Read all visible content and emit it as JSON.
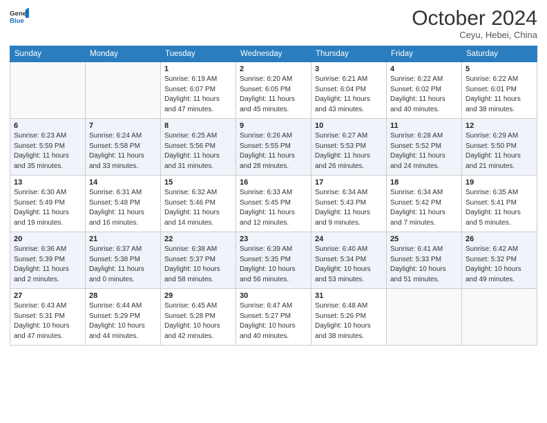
{
  "logo": {
    "general": "General",
    "blue": "Blue"
  },
  "title": "October 2024",
  "subtitle": "Ceyu, Hebei, China",
  "days_header": [
    "Sunday",
    "Monday",
    "Tuesday",
    "Wednesday",
    "Thursday",
    "Friday",
    "Saturday"
  ],
  "weeks": [
    {
      "shade": false,
      "days": [
        {
          "num": "",
          "info": ""
        },
        {
          "num": "",
          "info": ""
        },
        {
          "num": "1",
          "info": "Sunrise: 6:19 AM\nSunset: 6:07 PM\nDaylight: 11 hours and 47 minutes."
        },
        {
          "num": "2",
          "info": "Sunrise: 6:20 AM\nSunset: 6:05 PM\nDaylight: 11 hours and 45 minutes."
        },
        {
          "num": "3",
          "info": "Sunrise: 6:21 AM\nSunset: 6:04 PM\nDaylight: 11 hours and 43 minutes."
        },
        {
          "num": "4",
          "info": "Sunrise: 6:22 AM\nSunset: 6:02 PM\nDaylight: 11 hours and 40 minutes."
        },
        {
          "num": "5",
          "info": "Sunrise: 6:22 AM\nSunset: 6:01 PM\nDaylight: 11 hours and 38 minutes."
        }
      ]
    },
    {
      "shade": true,
      "days": [
        {
          "num": "6",
          "info": "Sunrise: 6:23 AM\nSunset: 5:59 PM\nDaylight: 11 hours and 35 minutes."
        },
        {
          "num": "7",
          "info": "Sunrise: 6:24 AM\nSunset: 5:58 PM\nDaylight: 11 hours and 33 minutes."
        },
        {
          "num": "8",
          "info": "Sunrise: 6:25 AM\nSunset: 5:56 PM\nDaylight: 11 hours and 31 minutes."
        },
        {
          "num": "9",
          "info": "Sunrise: 6:26 AM\nSunset: 5:55 PM\nDaylight: 11 hours and 28 minutes."
        },
        {
          "num": "10",
          "info": "Sunrise: 6:27 AM\nSunset: 5:53 PM\nDaylight: 11 hours and 26 minutes."
        },
        {
          "num": "11",
          "info": "Sunrise: 6:28 AM\nSunset: 5:52 PM\nDaylight: 11 hours and 24 minutes."
        },
        {
          "num": "12",
          "info": "Sunrise: 6:29 AM\nSunset: 5:50 PM\nDaylight: 11 hours and 21 minutes."
        }
      ]
    },
    {
      "shade": false,
      "days": [
        {
          "num": "13",
          "info": "Sunrise: 6:30 AM\nSunset: 5:49 PM\nDaylight: 11 hours and 19 minutes."
        },
        {
          "num": "14",
          "info": "Sunrise: 6:31 AM\nSunset: 5:48 PM\nDaylight: 11 hours and 16 minutes."
        },
        {
          "num": "15",
          "info": "Sunrise: 6:32 AM\nSunset: 5:46 PM\nDaylight: 11 hours and 14 minutes."
        },
        {
          "num": "16",
          "info": "Sunrise: 6:33 AM\nSunset: 5:45 PM\nDaylight: 11 hours and 12 minutes."
        },
        {
          "num": "17",
          "info": "Sunrise: 6:34 AM\nSunset: 5:43 PM\nDaylight: 11 hours and 9 minutes."
        },
        {
          "num": "18",
          "info": "Sunrise: 6:34 AM\nSunset: 5:42 PM\nDaylight: 11 hours and 7 minutes."
        },
        {
          "num": "19",
          "info": "Sunrise: 6:35 AM\nSunset: 5:41 PM\nDaylight: 11 hours and 5 minutes."
        }
      ]
    },
    {
      "shade": true,
      "days": [
        {
          "num": "20",
          "info": "Sunrise: 6:36 AM\nSunset: 5:39 PM\nDaylight: 11 hours and 2 minutes."
        },
        {
          "num": "21",
          "info": "Sunrise: 6:37 AM\nSunset: 5:38 PM\nDaylight: 11 hours and 0 minutes."
        },
        {
          "num": "22",
          "info": "Sunrise: 6:38 AM\nSunset: 5:37 PM\nDaylight: 10 hours and 58 minutes."
        },
        {
          "num": "23",
          "info": "Sunrise: 6:39 AM\nSunset: 5:35 PM\nDaylight: 10 hours and 56 minutes."
        },
        {
          "num": "24",
          "info": "Sunrise: 6:40 AM\nSunset: 5:34 PM\nDaylight: 10 hours and 53 minutes."
        },
        {
          "num": "25",
          "info": "Sunrise: 6:41 AM\nSunset: 5:33 PM\nDaylight: 10 hours and 51 minutes."
        },
        {
          "num": "26",
          "info": "Sunrise: 6:42 AM\nSunset: 5:32 PM\nDaylight: 10 hours and 49 minutes."
        }
      ]
    },
    {
      "shade": false,
      "days": [
        {
          "num": "27",
          "info": "Sunrise: 6:43 AM\nSunset: 5:31 PM\nDaylight: 10 hours and 47 minutes."
        },
        {
          "num": "28",
          "info": "Sunrise: 6:44 AM\nSunset: 5:29 PM\nDaylight: 10 hours and 44 minutes."
        },
        {
          "num": "29",
          "info": "Sunrise: 6:45 AM\nSunset: 5:28 PM\nDaylight: 10 hours and 42 minutes."
        },
        {
          "num": "30",
          "info": "Sunrise: 6:47 AM\nSunset: 5:27 PM\nDaylight: 10 hours and 40 minutes."
        },
        {
          "num": "31",
          "info": "Sunrise: 6:48 AM\nSunset: 5:26 PM\nDaylight: 10 hours and 38 minutes."
        },
        {
          "num": "",
          "info": ""
        },
        {
          "num": "",
          "info": ""
        }
      ]
    }
  ]
}
